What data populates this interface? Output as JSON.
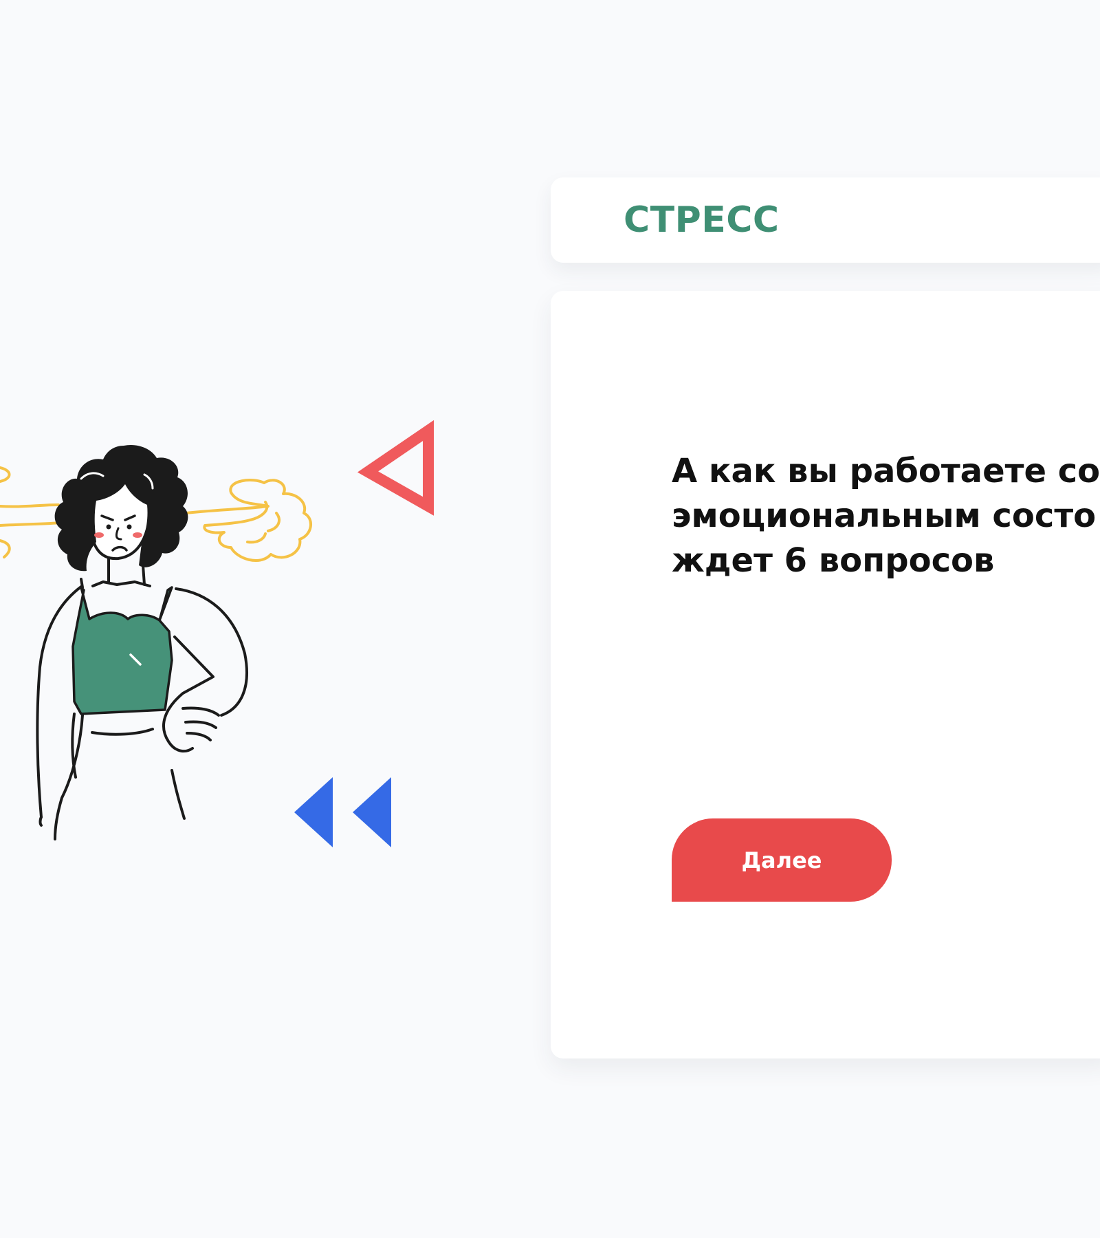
{
  "header": {
    "title": "СТРЕСС"
  },
  "question": {
    "text": "А как вы работаете со\nэмоциональным состо\nждет 6 вопросов"
  },
  "actions": {
    "next_label": "Далее"
  },
  "colors": {
    "background": "#f9fafc",
    "title_green": "#3f8f74",
    "button_red": "#e84a4b",
    "triangle_red": "#f05a5c",
    "triangle_blue": "#356ae6",
    "top_green": "#469279",
    "steam_yellow": "#f5c246"
  },
  "illustration": {
    "icons": [
      "stressed-woman-illustration",
      "red-outline-triangle-icon",
      "blue-double-triangle-icon"
    ]
  }
}
